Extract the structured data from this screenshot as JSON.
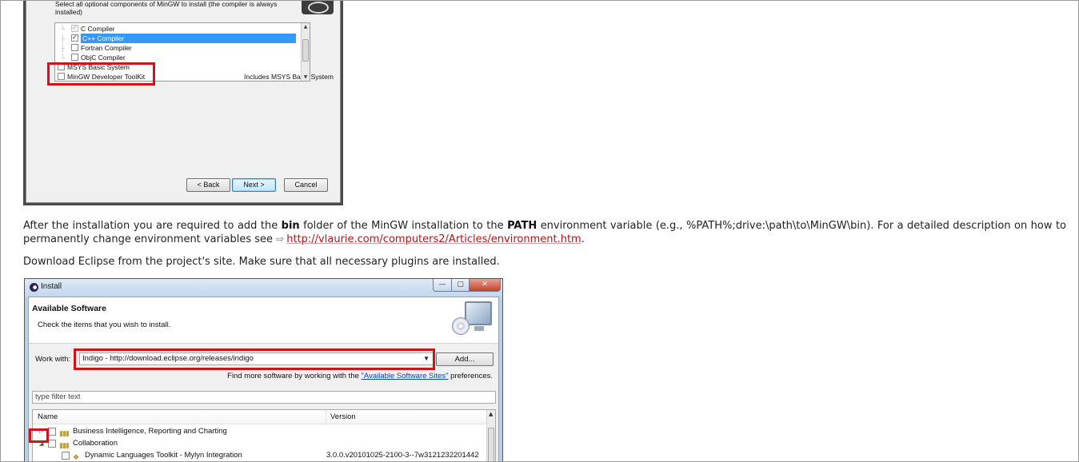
{
  "mingw_installer": {
    "description": "Select all optional components of MinGW to install (the compiler is always\ninstalled)",
    "components": [
      {
        "label": "C Compiler",
        "checked": true,
        "disabled": true,
        "indent": true
      },
      {
        "label": "C++ Compiler",
        "checked": true,
        "selected": true,
        "indent": true
      },
      {
        "label": "Fortran Compiler",
        "checked": false,
        "indent": true
      },
      {
        "label": "ObjC Compiler",
        "checked": false,
        "indent": true
      },
      {
        "label": "MSYS Basic System",
        "checked": false,
        "indent": false
      },
      {
        "label": "MinGW Developer ToolKit",
        "checked": false,
        "indent": false
      }
    ],
    "component_description": "Includes MSYS Basic System",
    "buttons": {
      "back": "< Back",
      "next": "Next >",
      "cancel": "Cancel"
    }
  },
  "article": {
    "p1_before_bin": "After the installation you are required to add the ",
    "p1_bin": "bin",
    "p1_mid": " folder of the MinGW installation to the ",
    "p1_path": "PATH",
    "p1_after": " environment variable (e.g., %PATH%;drive:\\path\\to\\MinGW\\bin). For a detailed description on how to permanently change environment variables see ",
    "p1_link": "http://vlaurie.com/computers2/Articles/environment.htm",
    "p1_end": ".",
    "p2": "Download Eclipse from the project's site. Make sure that all necessary plugins are installed."
  },
  "eclipse_install": {
    "window_title": "Install",
    "controls": {
      "minimize": "—",
      "maximize": "▢",
      "close": "✕"
    },
    "header_title": "Available Software",
    "header_subtitle": "Check the items that you wish to install.",
    "work_with_label": "Work with:",
    "work_with_value": "Indigo - http://download.eclipse.org/releases/indigo",
    "add_button": "Add...",
    "find_more_before": "Find more software by working with the ",
    "find_more_link": "\"Available Software Sites\"",
    "find_more_after": " preferences.",
    "filter_placeholder": "type filter text",
    "columns": {
      "name": "Name",
      "version": "Version"
    },
    "rows": [
      {
        "name": "Business Intelligence, Reporting and Charting",
        "version": "",
        "expanded": false,
        "level": 0
      },
      {
        "name": "Collaboration",
        "version": "",
        "expanded": true,
        "level": 0
      },
      {
        "name": "Dynamic Languages Toolkit - Mylyn Integration",
        "version": "3.0.0.v20101025-2100-3--7w3121232201442",
        "level": 1
      }
    ]
  }
}
